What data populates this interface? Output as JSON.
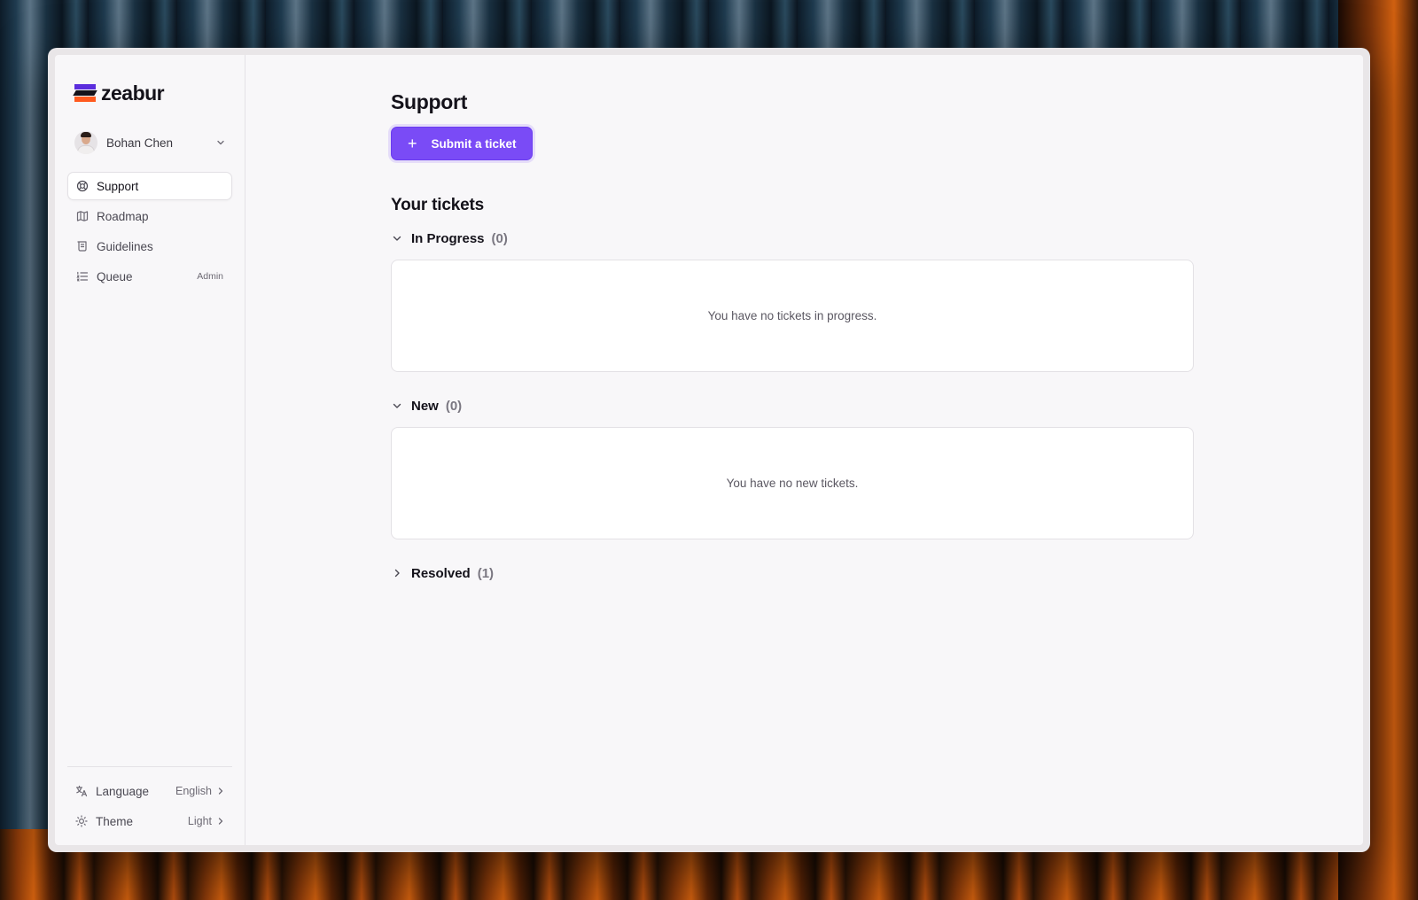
{
  "brand": {
    "name": "zeabur"
  },
  "user": {
    "name": "Bohan Chen"
  },
  "nav": {
    "items": [
      {
        "label": "Support",
        "icon": "lifebuoy-icon",
        "active": true
      },
      {
        "label": "Roadmap",
        "icon": "map-icon",
        "active": false
      },
      {
        "label": "Guidelines",
        "icon": "scroll-icon",
        "active": false
      },
      {
        "label": "Queue",
        "icon": "list-icon",
        "active": false,
        "badge": "Admin"
      }
    ]
  },
  "settings": {
    "language": {
      "label": "Language",
      "value": "English"
    },
    "theme": {
      "label": "Theme",
      "value": "Light"
    }
  },
  "main": {
    "title": "Support",
    "submit_label": "Submit a ticket",
    "section_title": "Your tickets",
    "groups": [
      {
        "label": "In Progress",
        "count": "(0)",
        "expanded": true,
        "empty_text": "You have no tickets in progress."
      },
      {
        "label": "New",
        "count": "(0)",
        "expanded": true,
        "empty_text": "You have no new tickets."
      },
      {
        "label": "Resolved",
        "count": "(1)",
        "expanded": false
      }
    ]
  },
  "colors": {
    "accent": "#7a4bf6",
    "logo_purple": "#5b2ddd",
    "logo_orange": "#ff5a1f"
  }
}
